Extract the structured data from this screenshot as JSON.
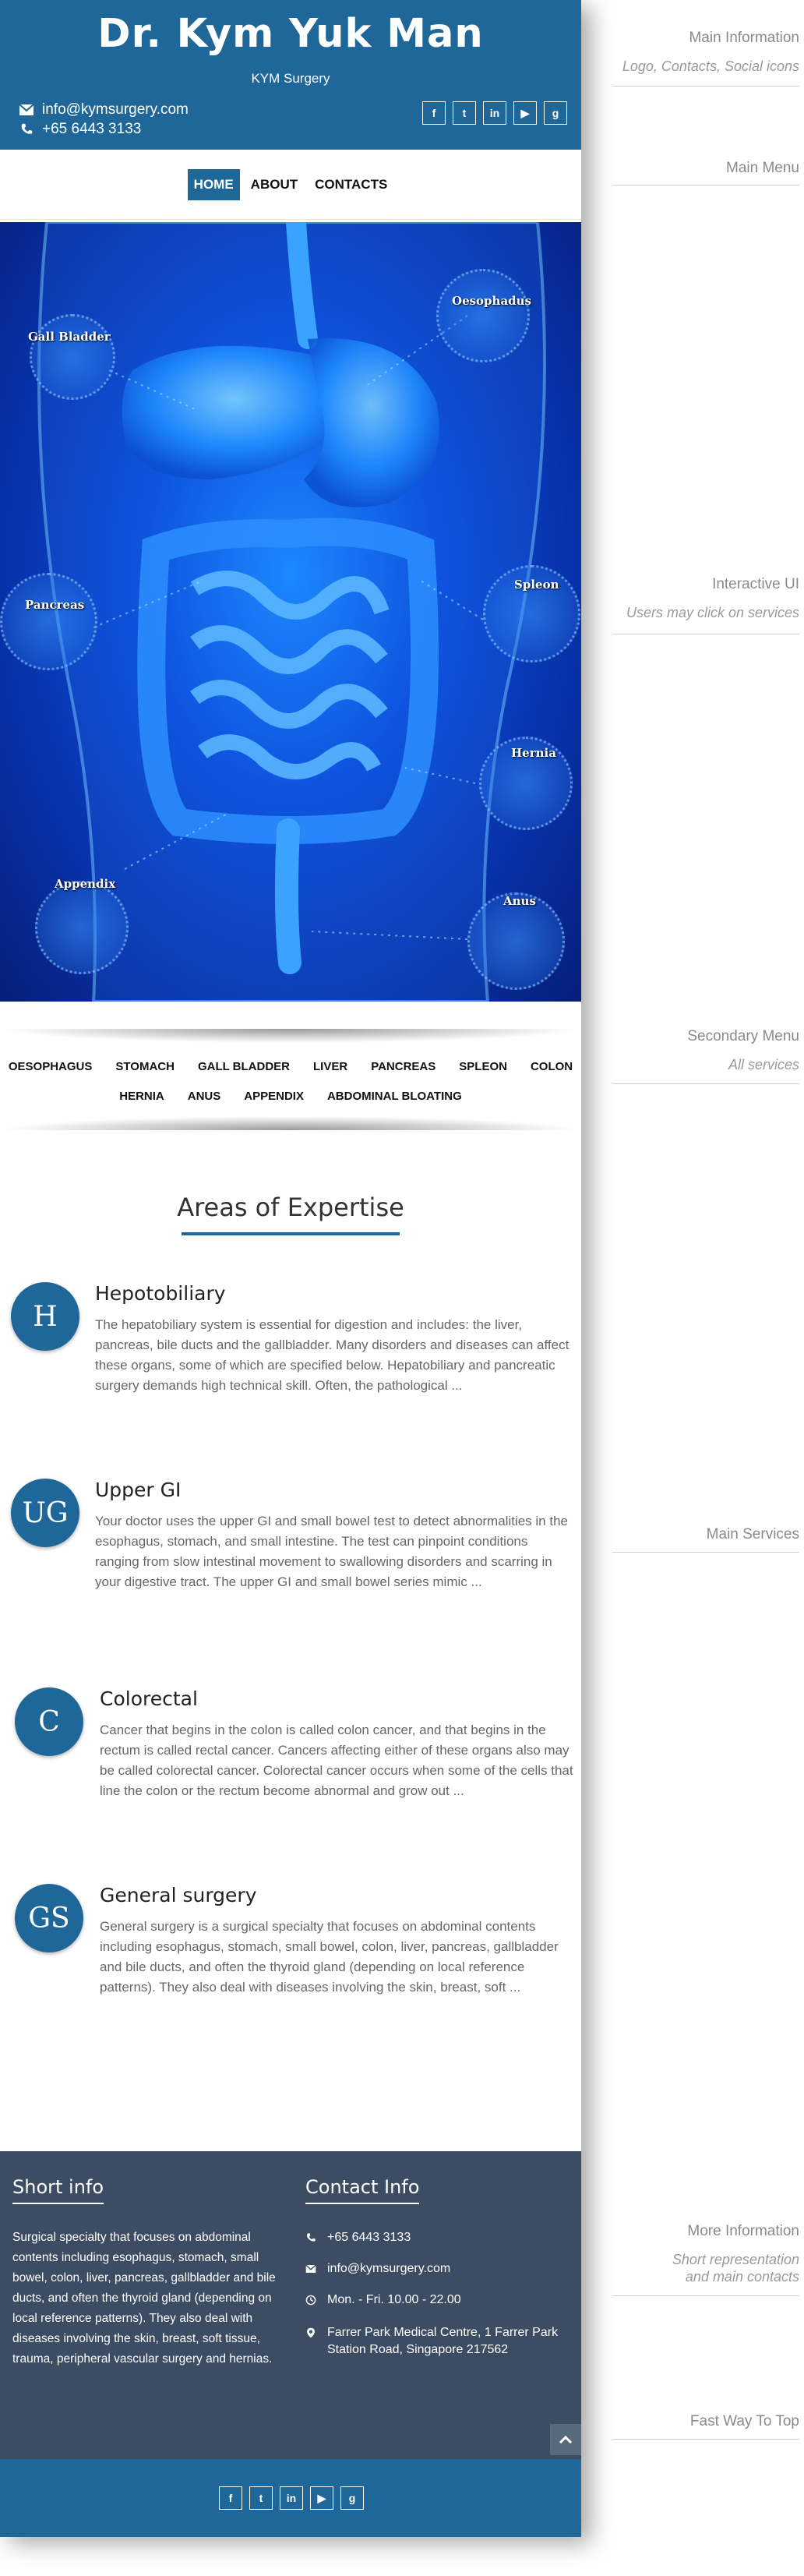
{
  "header": {
    "title": "Dr. Kym Yuk Man",
    "subtitle": "KYM Surgery",
    "email": "info@kymsurgery.com",
    "phone": "+65 6443 3133",
    "social": [
      {
        "icon": "facebook-icon",
        "glyph": "f"
      },
      {
        "icon": "twitter-icon",
        "glyph": "t"
      },
      {
        "icon": "linkedin-icon",
        "glyph": "in"
      },
      {
        "icon": "youtube-icon",
        "glyph": "▶"
      },
      {
        "icon": "google-plus-icon",
        "glyph": "g"
      }
    ]
  },
  "main_menu": {
    "items": [
      "HOME",
      "ABOUT",
      "CONTACTS"
    ],
    "active": "HOME"
  },
  "anatomy": {
    "labels": {
      "gall_bladder": "Gall Bladder",
      "oesophadus": "Oesophadus",
      "pancreas": "Pancreas",
      "spleon": "Spleon",
      "hernia": "Hernia",
      "appendix": "Appendix",
      "anus": "Anus"
    }
  },
  "secondary_menu": {
    "row1": [
      "OESOPHAGUS",
      "STOMACH",
      "GALL BLADDER",
      "LIVER",
      "PANCREAS",
      "SPLEON",
      "COLON"
    ],
    "row2": [
      "HERNIA",
      "ANUS",
      "APPENDIX",
      "ABDOMINAL BLOATING"
    ]
  },
  "expertise": {
    "title": "Areas of Expertise",
    "services": [
      {
        "initials": "H",
        "title": "Hepotobiliary",
        "text": "The hepatobiliary system is essential for digestion and includes: the liver, pancreas, bile ducts and the gallbladder. Many disorders and diseases can affect these organs, some of which are specified below. Hepatobiliary and pancreatic surgery demands high technical skill. Often, the pathological ..."
      },
      {
        "initials": "UG",
        "title": "Upper GI",
        "text": "Your doctor uses the upper GI and small bowel test to detect abnormalities in the esophagus, stomach, and small intestine. The test can pinpoint conditions ranging from slow intestinal movement to swallowing disorders and scarring in your digestive tract. The upper GI and small bowel series mimic ..."
      },
      {
        "initials": "C",
        "title": "Colorectal",
        "text": "Cancer that begins in the colon is called colon cancer, and that begins in the rectum is called rectal cancer. Cancers affecting either of these organs also may be called colorectal cancer. Colorectal cancer occurs when some of the cells that line the colon or the rectum become abnormal and grow out ..."
      },
      {
        "initials": "GS",
        "title": "General surgery",
        "text": "General surgery is a surgical specialty that focuses on abdominal contents including esophagus, stomach, small bowel, colon, liver, pancreas, gallbladder and bile ducts, and often the thyroid gland (depending on local reference patterns). They also deal with diseases involving the skin, breast, soft ..."
      }
    ]
  },
  "footer": {
    "short_info_title": "Short info",
    "short_info_text": "Surgical specialty that focuses on abdominal contents including esophagus, stomach, small bowel, colon, liver, pancreas, gallbladder and bile ducts, and often the thyroid gland (depending on local reference patterns). They also deal with diseases involving the skin, breast, soft tissue, trauma, peripheral vascular surgery and hernias.",
    "contact_title": "Contact Info",
    "phone": "+65 6443 3133",
    "email": "info@kymsurgery.com",
    "hours": "Mon. - Fri. 10.00 - 22.00",
    "address": "Farrer Park Medical Centre, 1 Farrer Park Station Road, Singapore 217562"
  },
  "annotations": {
    "main_information": "Main Information",
    "main_information_sub": "Logo, Contacts, Social icons",
    "main_menu": "Main Menu",
    "interactive_ui": "Interactive UI",
    "interactive_ui_sub": "Users may click on services",
    "secondary_menu": "Secondary Menu",
    "secondary_menu_sub": "All services",
    "main_services": "Main Services",
    "more_information": "More Information",
    "more_information_sub_1": "Short  representation",
    "more_information_sub_2": "and main contacts",
    "fast_way_to_top": "Fast Way To Top"
  },
  "colors": {
    "brand_blue": "#1e6798",
    "footer_bg": "#3b4c63",
    "anatomy_blue": "#0a4bd8"
  }
}
